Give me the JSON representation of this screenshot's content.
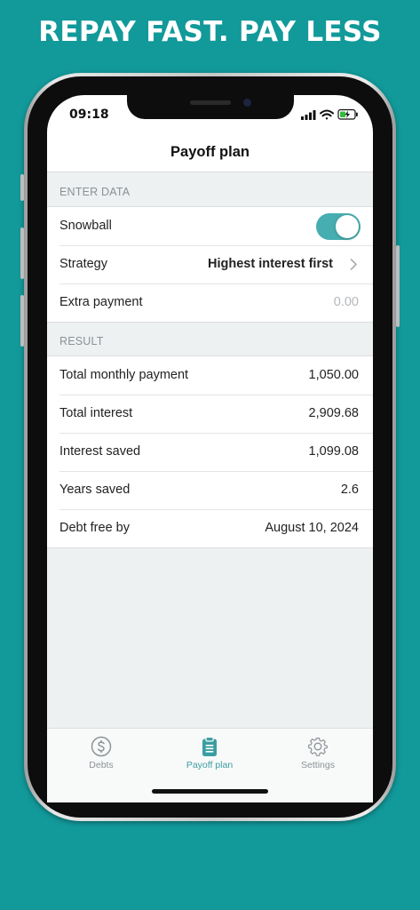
{
  "headline": "REPAY FAST. PAY LESS",
  "status_bar": {
    "time": "09:18"
  },
  "nav": {
    "title": "Payoff plan"
  },
  "enter_data": {
    "header": "ENTER DATA",
    "snowball": {
      "label": "Snowball",
      "enabled": true
    },
    "strategy": {
      "label": "Strategy",
      "value": "Highest interest first"
    },
    "extra_payment": {
      "label": "Extra payment",
      "placeholder": "0.00"
    }
  },
  "result": {
    "header": "RESULT",
    "rows": [
      {
        "label": "Total monthly payment",
        "value": "1,050.00"
      },
      {
        "label": "Total interest",
        "value": "2,909.68"
      },
      {
        "label": "Interest saved",
        "value": "1,099.08"
      },
      {
        "label": "Years saved",
        "value": "2.6"
      },
      {
        "label": "Debt free by",
        "value": "August 10, 2024"
      }
    ]
  },
  "tabs": [
    {
      "label": "Debts",
      "icon": "dollar-circle-icon",
      "active": false
    },
    {
      "label": "Payoff plan",
      "icon": "clipboard-icon",
      "active": true
    },
    {
      "label": "Settings",
      "icon": "gear-icon",
      "active": false
    }
  ],
  "colors": {
    "background": "#12999a",
    "accent": "#46aeb0",
    "active_tab": "#3a9ea0",
    "inactive_tab": "#8d9398"
  }
}
